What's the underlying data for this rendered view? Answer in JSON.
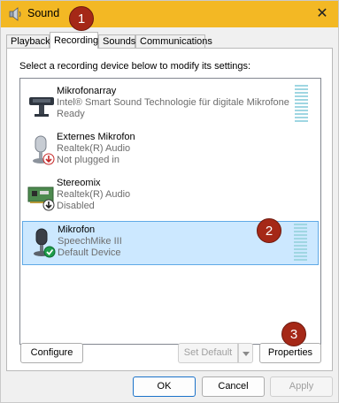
{
  "window": {
    "title": "Sound",
    "close_glyph": "✕"
  },
  "badges": [
    "1",
    "2",
    "3"
  ],
  "tabs": [
    "Playback",
    "Recording",
    "Sounds",
    "Communications"
  ],
  "active_tab": "Recording",
  "instruction": "Select a recording device below to modify its settings:",
  "devices": [
    {
      "name": "Mikrofonarray",
      "line1": "Intel® Smart Sound Technologie für digitale Mikrofone",
      "line2": "Ready",
      "icon": "array-mic-icon",
      "selected": false
    },
    {
      "name": "Externes Mikrofon",
      "line1": "Realtek(R) Audio",
      "line2": "Not plugged in",
      "icon": "microphone-icon",
      "status_icon": "unplugged-icon",
      "selected": false
    },
    {
      "name": "Stereomix",
      "line1": "Realtek(R) Audio",
      "line2": "Disabled",
      "icon": "circuit-board-icon",
      "status_icon": "disabled-icon",
      "selected": false
    },
    {
      "name": "Mikrofon",
      "line1": "SpeechMike III",
      "line2": "Default Device",
      "icon": "microphone-icon",
      "status_icon": "default-check-icon",
      "selected": true
    }
  ],
  "buttons": {
    "configure": "Configure",
    "set_default": "Set Default",
    "properties": "Properties",
    "ok": "OK",
    "cancel": "Cancel",
    "apply": "Apply"
  },
  "colors": {
    "titlebar": "#f3b824",
    "badge": "#a52817",
    "selection": "#cce8ff",
    "meter": "#9fd6e2"
  }
}
